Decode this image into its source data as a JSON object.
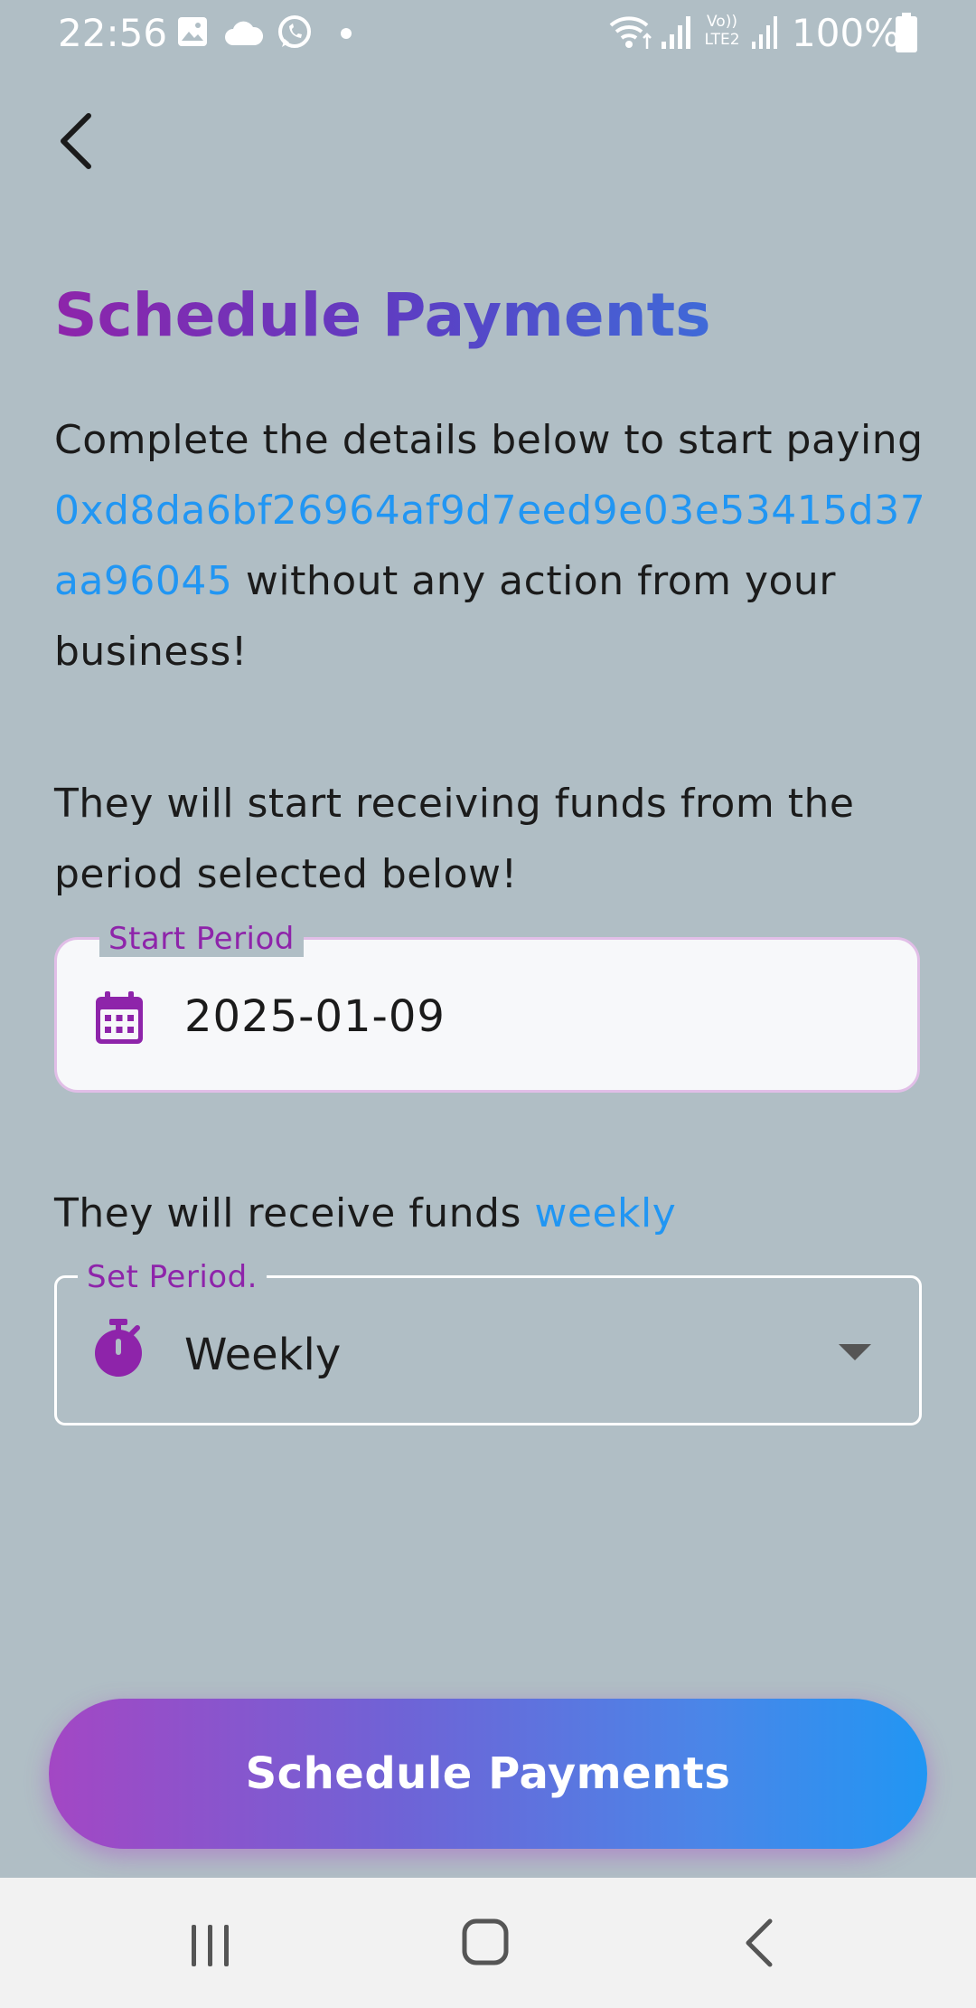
{
  "status_bar": {
    "time": "22:56",
    "battery_percent": "100%",
    "notification_icons": [
      "image-icon",
      "cloud-icon",
      "whatsapp-icon",
      "dot-icon"
    ],
    "system_icons": [
      "wifi-icon",
      "signal-icon",
      "volte-lte2-icon",
      "signal-icon",
      "battery-icon"
    ],
    "volte_label": "Vo))",
    "lte_label": "LTE2"
  },
  "header": {
    "back_icon": "chevron-left-icon"
  },
  "title": "Schedule Payments",
  "intro": {
    "before": "Complete the details below to start paying ",
    "address": "0xd8da6bf26964af9d7eed9e03e53415d37aa96045",
    "after": " without any action from your business!"
  },
  "start_info": "They will start receiving funds from the period selected below!",
  "start_field": {
    "label": "Start Period",
    "value": "2025-01-09",
    "icon": "calendar-icon"
  },
  "frequency_info": {
    "prefix": "They will receive funds ",
    "value": "weekly"
  },
  "period_field": {
    "label": "Set Period.",
    "value": "Weekly",
    "icon": "timer-icon",
    "arrow_icon": "dropdown-arrow-icon"
  },
  "cta_label": "Schedule Payments",
  "colors": {
    "background": "#b0bec5",
    "accent_blue": "#2196f3",
    "accent_purple": "#8e24aa",
    "field_border": "#e1bee7"
  },
  "navbar": {
    "icons": [
      "recent-apps-icon",
      "home-icon",
      "back-icon"
    ]
  }
}
